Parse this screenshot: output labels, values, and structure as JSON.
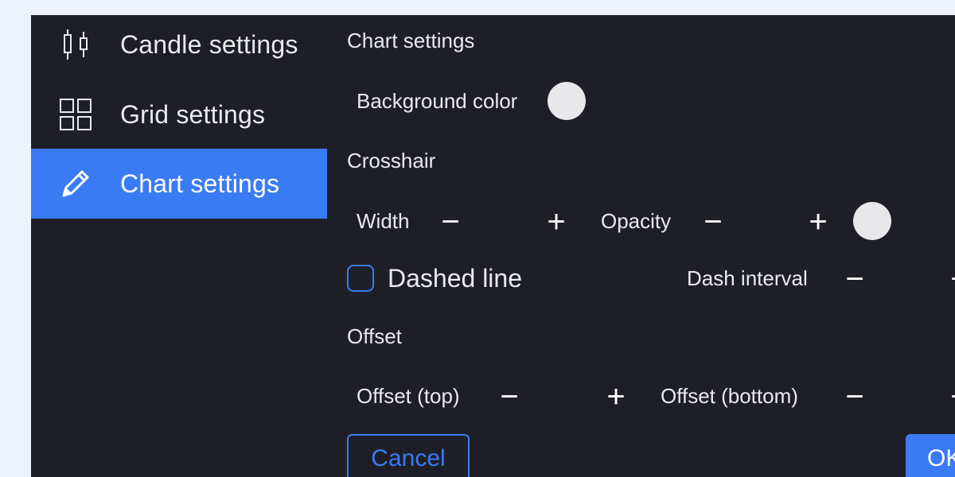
{
  "sidebar": {
    "items": [
      {
        "label": "Candle settings",
        "icon": "candlestick-icon",
        "active": false
      },
      {
        "label": "Grid settings",
        "icon": "grid-icon",
        "active": false
      },
      {
        "label": "Chart settings",
        "icon": "pencil-icon",
        "active": true
      }
    ]
  },
  "main": {
    "title": "Chart settings",
    "background": {
      "label": "Background color",
      "color": "#e8e8ea"
    },
    "crosshair": {
      "title": "Crosshair",
      "width_label": "Width",
      "opacity_label": "Opacity",
      "color": "#e8e8ea",
      "minus_glyph": "−",
      "plus_glyph": "+",
      "dashed_label": "Dashed line",
      "dashed_checked": false,
      "dash_interval_label": "Dash interval"
    },
    "offset": {
      "title": "Offset",
      "top_label": "Offset (top)",
      "bottom_label": "Offset (bottom)"
    },
    "cancel_label": "Cancel",
    "ok_label": "OK"
  },
  "colors": {
    "accent": "#3a7bf5",
    "panel_bg": "#1e1f26",
    "page_bg": "#eef3fb"
  }
}
